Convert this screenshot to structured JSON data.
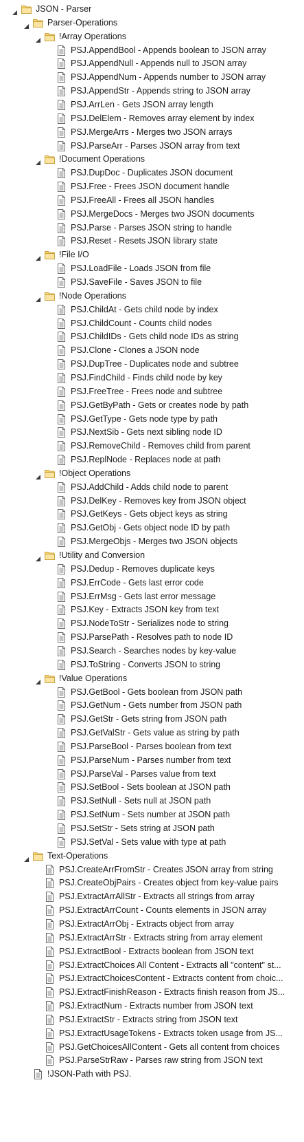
{
  "tree": [
    {
      "label": "JSON - Parser",
      "kind": "folder",
      "expanded": true,
      "depth": 0
    },
    {
      "label": "Parser-Operations",
      "kind": "folder",
      "expanded": true,
      "depth": 1
    },
    {
      "label": "!Array Operations",
      "kind": "folder",
      "expanded": true,
      "depth": 2
    },
    {
      "label": "PSJ.AppendBool - Appends boolean to JSON array",
      "kind": "doc",
      "depth": 3
    },
    {
      "label": "PSJ.AppendNull - Appends null to JSON array",
      "kind": "doc",
      "depth": 3
    },
    {
      "label": "PSJ.AppendNum - Appends number to JSON array",
      "kind": "doc",
      "depth": 3
    },
    {
      "label": "PSJ.AppendStr - Appends string to JSON array",
      "kind": "doc",
      "depth": 3
    },
    {
      "label": "PSJ.ArrLen - Gets JSON array length",
      "kind": "doc",
      "depth": 3
    },
    {
      "label": "PSJ.DelElem - Removes array element by index",
      "kind": "doc",
      "depth": 3
    },
    {
      "label": "PSJ.MergeArrs - Merges two JSON arrays",
      "kind": "doc",
      "depth": 3
    },
    {
      "label": "PSJ.ParseArr - Parses JSON array from text",
      "kind": "doc",
      "depth": 3
    },
    {
      "label": "!Document Operations",
      "kind": "folder",
      "expanded": true,
      "depth": 2
    },
    {
      "label": "PSJ.DupDoc - Duplicates JSON document",
      "kind": "doc",
      "depth": 3
    },
    {
      "label": "PSJ.Free - Frees JSON document handle",
      "kind": "doc",
      "depth": 3
    },
    {
      "label": "PSJ.FreeAll - Frees all JSON handles",
      "kind": "doc",
      "depth": 3
    },
    {
      "label": "PSJ.MergeDocs - Merges two JSON documents",
      "kind": "doc",
      "depth": 3
    },
    {
      "label": "PSJ.Parse - Parses JSON string to handle",
      "kind": "doc",
      "depth": 3
    },
    {
      "label": "PSJ.Reset - Resets JSON library state",
      "kind": "doc",
      "depth": 3
    },
    {
      "label": "!File I/O",
      "kind": "folder",
      "expanded": true,
      "depth": 2
    },
    {
      "label": "PSJ.LoadFile - Loads JSON from file",
      "kind": "doc",
      "depth": 3
    },
    {
      "label": "PSJ.SaveFile - Saves JSON to file",
      "kind": "doc",
      "depth": 3
    },
    {
      "label": "!Node Operations",
      "kind": "folder",
      "expanded": true,
      "depth": 2
    },
    {
      "label": "PSJ.ChildAt - Gets child node by index",
      "kind": "doc",
      "depth": 3
    },
    {
      "label": "PSJ.ChildCount - Counts child nodes",
      "kind": "doc",
      "depth": 3
    },
    {
      "label": "PSJ.ChildIDs - Gets child node IDs as string",
      "kind": "doc",
      "depth": 3
    },
    {
      "label": "PSJ.Clone - Clones a JSON node",
      "kind": "doc",
      "depth": 3
    },
    {
      "label": "PSJ.DupTree - Duplicates node and subtree",
      "kind": "doc",
      "depth": 3
    },
    {
      "label": "PSJ.FindChild - Finds child node by key",
      "kind": "doc",
      "depth": 3
    },
    {
      "label": "PSJ.FreeTree - Frees node and subtree",
      "kind": "doc",
      "depth": 3
    },
    {
      "label": "PSJ.GetByPath - Gets or creates node by path",
      "kind": "doc",
      "depth": 3
    },
    {
      "label": "PSJ.GetType - Gets node type by path",
      "kind": "doc",
      "depth": 3
    },
    {
      "label": "PSJ.NextSib - Gets next sibling node ID",
      "kind": "doc",
      "depth": 3
    },
    {
      "label": "PSJ.RemoveChild - Removes child from parent",
      "kind": "doc",
      "depth": 3
    },
    {
      "label": "PSJ.ReplNode - Replaces node at path",
      "kind": "doc",
      "depth": 3
    },
    {
      "label": "!Object Operations",
      "kind": "folder",
      "expanded": true,
      "depth": 2
    },
    {
      "label": "PSJ.AddChild - Adds child node to parent",
      "kind": "doc",
      "depth": 3
    },
    {
      "label": "PSJ.DelKey - Removes key from JSON object",
      "kind": "doc",
      "depth": 3
    },
    {
      "label": "PSJ.GetKeys - Gets object keys as string",
      "kind": "doc",
      "depth": 3
    },
    {
      "label": "PSJ.GetObj - Gets object node ID by path",
      "kind": "doc",
      "depth": 3
    },
    {
      "label": "PSJ.MergeObjs - Merges two JSON objects",
      "kind": "doc",
      "depth": 3
    },
    {
      "label": "!Utility and Conversion",
      "kind": "folder",
      "expanded": true,
      "depth": 2
    },
    {
      "label": "PSJ.Dedup - Removes duplicate keys",
      "kind": "doc",
      "depth": 3
    },
    {
      "label": "PSJ.ErrCode - Gets last error code",
      "kind": "doc",
      "depth": 3
    },
    {
      "label": "PSJ.ErrMsg - Gets last error message",
      "kind": "doc",
      "depth": 3
    },
    {
      "label": "PSJ.Key - Extracts JSON key from text",
      "kind": "doc",
      "depth": 3
    },
    {
      "label": "PSJ.NodeToStr - Serializes node to string",
      "kind": "doc",
      "depth": 3
    },
    {
      "label": "PSJ.ParsePath - Resolves path to node ID",
      "kind": "doc",
      "depth": 3
    },
    {
      "label": "PSJ.Search - Searches nodes by key-value",
      "kind": "doc",
      "depth": 3
    },
    {
      "label": "PSJ.ToString - Converts JSON to string",
      "kind": "doc",
      "depth": 3
    },
    {
      "label": "!Value Operations",
      "kind": "folder",
      "expanded": true,
      "depth": 2
    },
    {
      "label": "PSJ.GetBool - Gets boolean from JSON path",
      "kind": "doc",
      "depth": 3
    },
    {
      "label": "PSJ.GetNum - Gets number from JSON path",
      "kind": "doc",
      "depth": 3
    },
    {
      "label": "PSJ.GetStr - Gets string from JSON path",
      "kind": "doc",
      "depth": 3
    },
    {
      "label": "PSJ.GetValStr - Gets value as string by path",
      "kind": "doc",
      "depth": 3
    },
    {
      "label": "PSJ.ParseBool - Parses boolean from text",
      "kind": "doc",
      "depth": 3
    },
    {
      "label": "PSJ.ParseNum - Parses number from text",
      "kind": "doc",
      "depth": 3
    },
    {
      "label": "PSJ.ParseVal - Parses value from text",
      "kind": "doc",
      "depth": 3
    },
    {
      "label": "PSJ.SetBool - Sets boolean at JSON path",
      "kind": "doc",
      "depth": 3
    },
    {
      "label": "PSJ.SetNull - Sets null at JSON path",
      "kind": "doc",
      "depth": 3
    },
    {
      "label": "PSJ.SetNum - Sets number at JSON path",
      "kind": "doc",
      "depth": 3
    },
    {
      "label": "PSJ.SetStr - Sets string at JSON path",
      "kind": "doc",
      "depth": 3
    },
    {
      "label": "PSJ.SetVal - Sets value with type at path",
      "kind": "doc",
      "depth": 3
    },
    {
      "label": "Text-Operations",
      "kind": "folder",
      "expanded": true,
      "depth": 1
    },
    {
      "label": "PSJ.CreateArrFromStr - Creates JSON array from string",
      "kind": "doc",
      "depth": 2
    },
    {
      "label": "PSJ.CreateObjPairs - Creates object from key-value pairs",
      "kind": "doc",
      "depth": 2
    },
    {
      "label": "PSJ.ExtractArrAllStr - Extracts all strings from array",
      "kind": "doc",
      "depth": 2
    },
    {
      "label": "PSJ.ExtractArrCount - Counts elements in JSON array",
      "kind": "doc",
      "depth": 2
    },
    {
      "label": "PSJ.ExtractArrObj - Extracts object from array",
      "kind": "doc",
      "depth": 2
    },
    {
      "label": "PSJ.ExtractArrStr - Extracts string from array element",
      "kind": "doc",
      "depth": 2
    },
    {
      "label": "PSJ.ExtractBool - Extracts boolean from JSON text",
      "kind": "doc",
      "depth": 2
    },
    {
      "label": "PSJ.ExtractChoices All Content - Extracts all \"content\" st...",
      "kind": "doc",
      "depth": 2
    },
    {
      "label": "PSJ.ExtractChoicesContent - Extracts content from choic...",
      "kind": "doc",
      "depth": 2
    },
    {
      "label": "PSJ.ExtractFinishReason - Extracts finish reason from JS...",
      "kind": "doc",
      "depth": 2
    },
    {
      "label": "PSJ.ExtractNum - Extracts number from JSON text",
      "kind": "doc",
      "depth": 2
    },
    {
      "label": "PSJ.ExtractStr - Extracts string from JSON text",
      "kind": "doc",
      "depth": 2
    },
    {
      "label": "PSJ.ExtractUsageTokens - Extracts token usage from JS...",
      "kind": "doc",
      "depth": 2
    },
    {
      "label": "PSJ.GetChoicesAllContent - Gets all content from choices",
      "kind": "doc",
      "depth": 2
    },
    {
      "label": "PSJ.ParseStrRaw - Parses raw string from JSON text",
      "kind": "doc",
      "depth": 2
    },
    {
      "label": "!JSON-Path with PSJ.",
      "kind": "doc",
      "depth": 1
    }
  ],
  "icon_names": {
    "folder": "folder-icon",
    "doc": "document-icon",
    "arrow": "expand-arrow-icon"
  },
  "colors": {
    "folder_fill": "#f8d775",
    "folder_stroke": "#c9a23c",
    "doc_stroke": "#6b6b6b",
    "arrow": "#3c3c3c"
  }
}
